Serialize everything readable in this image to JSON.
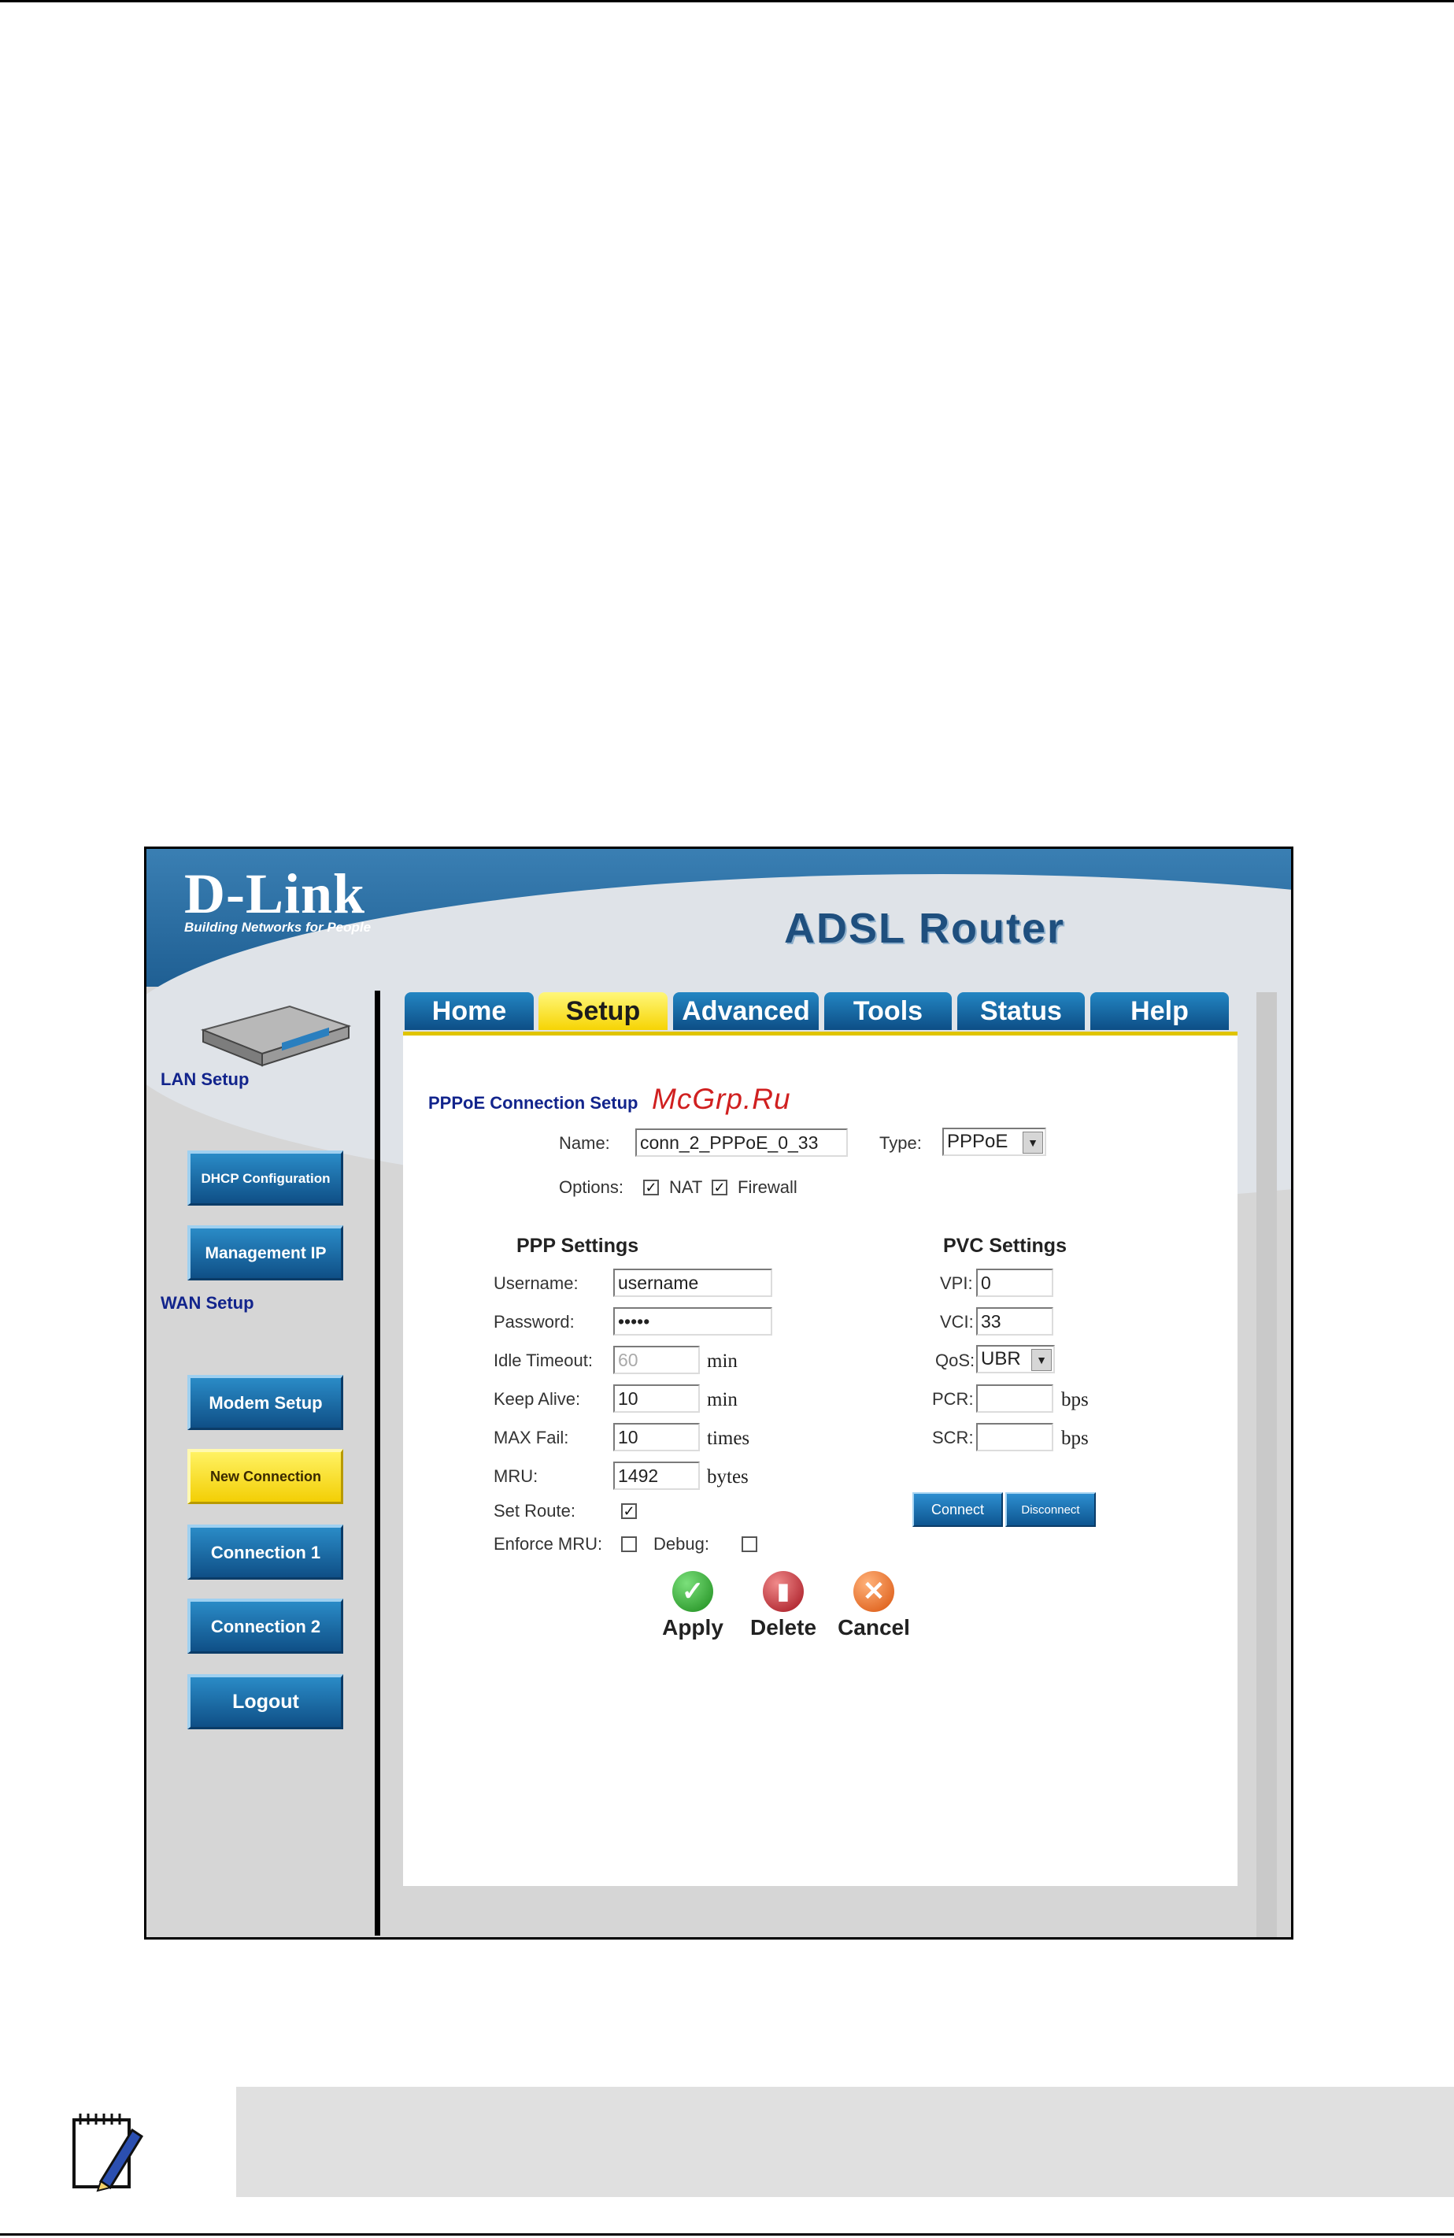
{
  "header": {
    "brand": "D-Link",
    "tagline": "Building Networks for People",
    "product_title": "ADSL Router"
  },
  "tabs": [
    {
      "label": "Home",
      "active": false
    },
    {
      "label": "Setup",
      "active": true
    },
    {
      "label": "Advanced",
      "active": false
    },
    {
      "label": "Tools",
      "active": false
    },
    {
      "label": "Status",
      "active": false
    },
    {
      "label": "Help",
      "active": false
    }
  ],
  "sidebar": {
    "lan_label": "LAN Setup",
    "wan_label": "WAN Setup",
    "buttons": {
      "dhcp": "DHCP Configuration",
      "management_ip": "Management IP",
      "modem_setup": "Modem Setup",
      "new_connection": "New Connection",
      "connection1": "Connection 1",
      "connection2": "Connection 2",
      "logout": "Logout"
    }
  },
  "form": {
    "title": "PPPoE Connection Setup",
    "name_label": "Name:",
    "name_value": "conn_2_PPPoE_0_33",
    "type_label": "Type:",
    "type_value": "PPPoE",
    "options_label": "Options:",
    "nat_label": "NAT",
    "firewall_label": "Firewall",
    "nat_checked": true,
    "firewall_checked": true
  },
  "ppp": {
    "title": "PPP Settings",
    "username_label": "Username:",
    "username_value": "username",
    "password_label": "Password:",
    "password_value": "*****",
    "idle_label": "Idle Timeout:",
    "idle_value": "60",
    "idle_unit": "min",
    "keepalive_label": "Keep Alive:",
    "keepalive_value": "10",
    "keepalive_unit": "min",
    "maxfail_label": "MAX Fail:",
    "maxfail_value": "10",
    "maxfail_unit": "times",
    "mru_label": "MRU:",
    "mru_value": "1492",
    "mru_unit": "bytes",
    "setroute_label": "Set Route:",
    "setroute_checked": true,
    "enforce_label": "Enforce MRU:",
    "enforce_checked": false,
    "debug_label": "Debug:",
    "debug_checked": false
  },
  "pvc": {
    "title": "PVC Settings",
    "vpi_label": "VPI:",
    "vpi_value": "0",
    "vci_label": "VCI:",
    "vci_value": "33",
    "qos_label": "QoS:",
    "qos_value": "UBR",
    "pcr_label": "PCR:",
    "pcr_value": "",
    "pcr_unit": "bps",
    "scr_label": "SCR:",
    "scr_value": "",
    "scr_unit": "bps",
    "connect_label": "Connect",
    "disconnect_label": "Disconnect"
  },
  "actions": {
    "apply": "Apply",
    "delete": "Delete",
    "cancel": "Cancel"
  },
  "watermark": "McGrp.Ru",
  "icons": {
    "apply": "checkmark-icon",
    "delete": "trash-icon",
    "cancel": "x-icon",
    "note": "notepad-pen-icon"
  },
  "colors": {
    "accent_blue": "#1f5f93",
    "tab_active": "#f6d404",
    "label_blue": "#12248c",
    "apply_green": "#2aa52a",
    "delete_red": "#c0303a",
    "cancel_orange": "#e8651a"
  }
}
